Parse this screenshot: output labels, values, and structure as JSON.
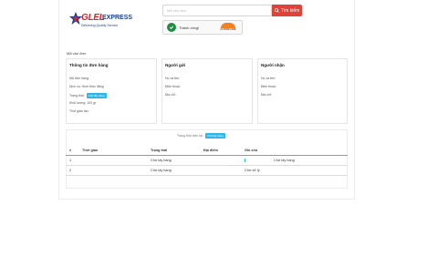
{
  "header": {
    "brand": "GLEL",
    "brand_suffix": "EXPRESS",
    "tagline": "Delivering Quality Service",
    "search_placeholder": "Mã vận đơn",
    "search_button_label": "Tìm kiếm",
    "captcha_label": "Thành công!",
    "captcha_brand": "CLOUDFLARE"
  },
  "tracking": {
    "section_title": "Mã vận đơn",
    "order_panel": {
      "title": "Thông tin đơn hàng",
      "fields": [
        {
          "label": "Mã đơn hàng:",
          "value": ""
        },
        {
          "label": "Dịch vụ: Hình thức đăng",
          "value": ""
        },
        {
          "label": "Trạng thái:",
          "value": "",
          "badge": "Chờ lấy hàng"
        },
        {
          "label": "Khối lượng: 100 gr",
          "value": ""
        },
        {
          "label": "Thời gian tạo:",
          "value": ""
        }
      ]
    },
    "sender_panel": {
      "title": "Người gửi",
      "fields": [
        {
          "label": "Họ và tên:",
          "value": ""
        },
        {
          "label": "Điện thoại:",
          "value": ""
        },
        {
          "label": "Địa chỉ:",
          "value": ""
        }
      ]
    },
    "receiver_panel": {
      "title": "Người nhận",
      "fields": [
        {
          "label": "Họ và tên:",
          "value": ""
        },
        {
          "label": "Điện thoại:",
          "value": ""
        },
        {
          "label": "Địa chỉ:",
          "value": ""
        }
      ]
    }
  },
  "history": {
    "status_label": "Trạng thái hiện tại:",
    "status_badge": "Chờ lấy hàng",
    "columns": [
      "#",
      "Thời gian",
      "Trạng thái",
      "Địa điểm",
      "Ghi chú"
    ],
    "rows": [
      {
        "num": "1",
        "time": "",
        "status": "Chờ lấy hàng",
        "place": "",
        "note": "Chờ lấy hàng"
      },
      {
        "num": "2",
        "time": "",
        "status": "Chờ lấy hàng",
        "place": "",
        "note": "Chờ xử lý"
      }
    ]
  },
  "colors": {
    "brand_red": "#e22127",
    "brand_blue": "#1c3f94",
    "search_button": "#dd4338",
    "badge": "#2fb6e8",
    "captcha_ok": "#1e8e3e"
  }
}
